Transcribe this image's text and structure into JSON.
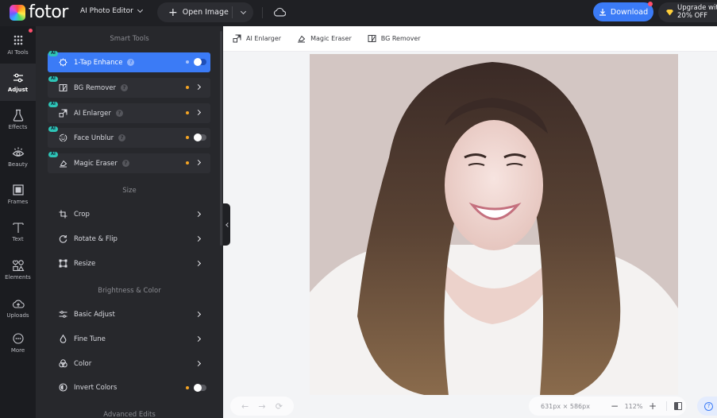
{
  "header": {
    "logo_text": "fotor",
    "app_menu": "AI Photo Editor",
    "open_image": "Open Image",
    "download": "Download",
    "upgrade_line1": "Upgrade with",
    "upgrade_line2": "20% OFF",
    "accent_color": "#3b7bf6"
  },
  "rail": {
    "items": [
      {
        "label": "AI Tools",
        "icon": "grid-dots-icon"
      },
      {
        "label": "Adjust",
        "icon": "sliders-icon",
        "active": true
      },
      {
        "label": "Effects",
        "icon": "flask-icon"
      },
      {
        "label": "Beauty",
        "icon": "eye-icon"
      },
      {
        "label": "Frames",
        "icon": "frame-icon"
      },
      {
        "label": "Text",
        "icon": "text-t-icon"
      },
      {
        "label": "Elements",
        "icon": "shapes-icon"
      },
      {
        "label": "Uploads",
        "icon": "cloud-upload-icon"
      },
      {
        "label": "More",
        "icon": "more-dots-icon"
      }
    ]
  },
  "panel": {
    "sections": {
      "smart_tools": "Smart Tools",
      "size": "Size",
      "brightness_color": "Brightness & Color",
      "advanced_edits": "Advanced Edits"
    },
    "smart_tools": [
      {
        "label": "1-Tap Enhance",
        "badge": "AI",
        "control": "toggle",
        "on": false,
        "active": true
      },
      {
        "label": "BG Remover",
        "badge": "AI",
        "control": "arrow"
      },
      {
        "label": "AI Enlarger",
        "badge": "AI",
        "control": "arrow"
      },
      {
        "label": "Face Unblur",
        "badge": "AI",
        "control": "toggle",
        "on": false
      },
      {
        "label": "Magic Eraser",
        "badge": "AI",
        "control": "arrow"
      }
    ],
    "size_tools": [
      {
        "label": "Crop"
      },
      {
        "label": "Rotate & Flip"
      },
      {
        "label": "Resize"
      }
    ],
    "color_tools": [
      {
        "label": "Basic Adjust"
      },
      {
        "label": "Fine Tune"
      },
      {
        "label": "Color"
      },
      {
        "label": "Invert Colors",
        "control": "toggle",
        "on": false
      }
    ],
    "help_glyph": "?"
  },
  "canvas": {
    "quick_tools": [
      "AI Enlarger",
      "Magic Eraser",
      "BG Remover"
    ],
    "undo": "←",
    "redo": "→",
    "history": "⟳",
    "dimensions": "631px × 586px",
    "zoom_out": "−",
    "zoom_level": "112%",
    "zoom_in": "+",
    "help": "?"
  }
}
